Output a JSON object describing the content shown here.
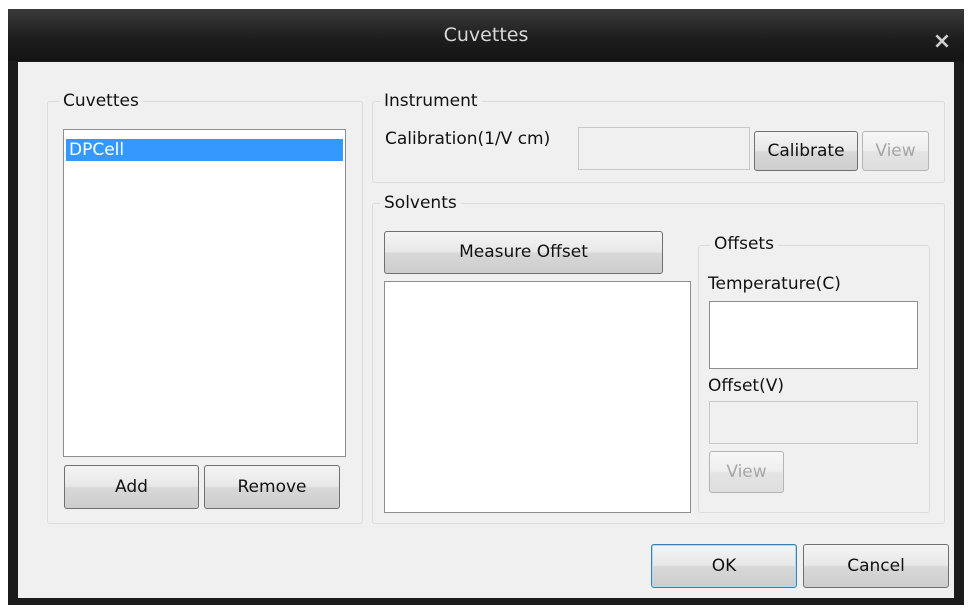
{
  "window": {
    "title": "Cuvettes",
    "close_icon": "×"
  },
  "cuvettes_group": {
    "legend": "Cuvettes",
    "items": [
      "DPCell"
    ],
    "add_label": "Add",
    "remove_label": "Remove"
  },
  "instrument_group": {
    "legend": "Instrument",
    "calibration_label": "Calibration(1/V cm)",
    "calibration_value": "",
    "calibrate_label": "Calibrate",
    "view_label": "View"
  },
  "solvents_group": {
    "legend": "Solvents",
    "measure_offset_label": "Measure Offset",
    "offsets": {
      "legend": "Offsets",
      "temperature_label": "Temperature(C)",
      "temperature_value": "",
      "offset_label": "Offset(V)",
      "offset_value": "",
      "view_label": "View"
    }
  },
  "footer": {
    "ok_label": "OK",
    "cancel_label": "Cancel"
  }
}
